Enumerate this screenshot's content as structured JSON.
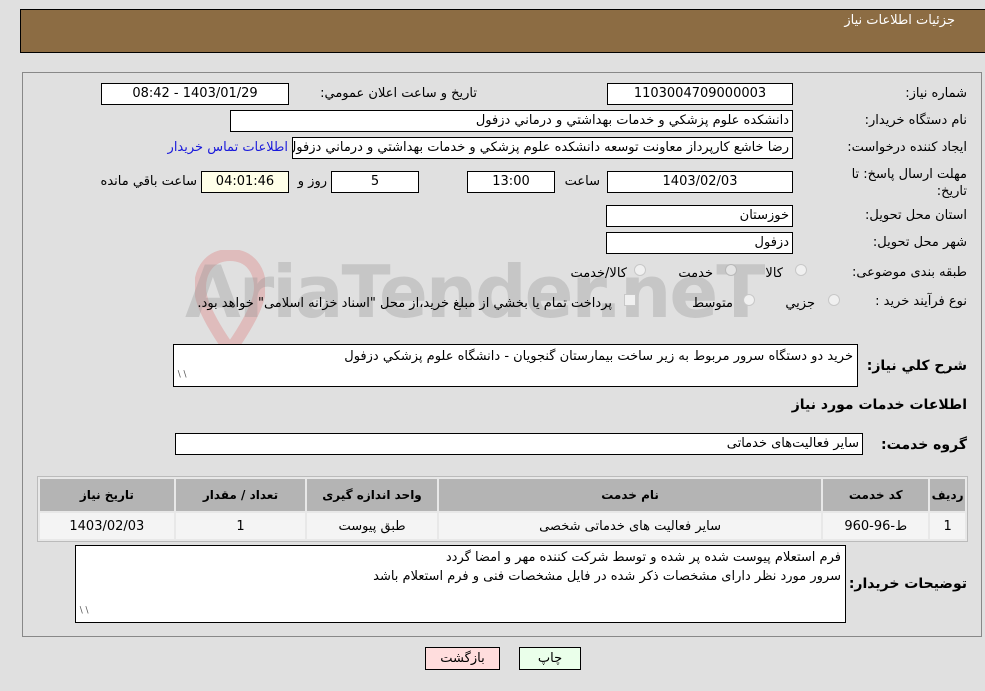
{
  "header": {
    "title": "جزئيات اطلاعات نياز"
  },
  "fields": {
    "need_number": {
      "label": "شماره نياز:",
      "value": "1103004709000003"
    },
    "announce_datetime": {
      "label": "تاريخ و ساعت اعلان عمومي:",
      "value": "1403/01/29 - 08:42"
    },
    "buyer_org": {
      "label": "نام دستگاه خريدار:",
      "value": "دانشكده علوم پزشكي و خدمات بهداشتي و درماني دزفول"
    },
    "requester": {
      "label": "ايجاد كننده درخواست:",
      "value": "رضا خاشع كارپرداز معاونت توسعه دانشكده علوم پزشكي و خدمات بهداشتي و درماني دزفول",
      "contact_link": "اطلاعات تماس خريدار"
    },
    "deadline": {
      "label": "مهلت ارسال پاسخ: تا تاريخ:",
      "date": "1403/02/03",
      "time_label": "ساعت",
      "time": "13:00",
      "days": "5",
      "days_label": "روز و",
      "remaining": "04:01:46",
      "remaining_label": "ساعت باقي مانده"
    },
    "province": {
      "label": "استان محل تحويل:",
      "value": "خوزستان"
    },
    "city": {
      "label": "شهر محل تحويل:",
      "value": "دزفول"
    },
    "category": {
      "label": "طبقه بندی موضوعی:",
      "options": [
        "كالا",
        "خدمت",
        "كالا/خدمت"
      ],
      "selected": "خدمت"
    },
    "purchase_type": {
      "label": "نوع فرآيند خريد :",
      "options": [
        "جزيي",
        "متوسط"
      ],
      "selected": "",
      "treasury_note": "پرداخت تمام يا بخشي از مبلغ خريد،از محل \"اسناد خزانه اسلامی\" خواهد بود."
    }
  },
  "description": {
    "label": "شرح كلي نياز:",
    "value": "خريد دو دستگاه سرور مربوط به زير ساخت بيمارستان گنجويان - دانشگاه علوم پزشكي دزفول"
  },
  "services_section": {
    "title": "اطلاعات خدمات مورد نياز"
  },
  "service_group": {
    "label": "گروه خدمت:",
    "value": "ساير فعاليت‌هاى خدماتى"
  },
  "table": {
    "columns": [
      "رديف",
      "كد خدمت",
      "نام خدمت",
      "واحد اندازه گيری",
      "تعداد / مقدار",
      "تاريخ نياز"
    ],
    "rows": [
      [
        "1",
        "ط-96-960",
        "ساير فعاليت هاى خدماتى شخصى",
        "طبق پيوست",
        "1",
        "1403/02/03"
      ]
    ]
  },
  "buyer_notes": {
    "label": "توضيحات خريدار:",
    "lines": [
      "فرم استعلام پيوست شده پر شده و توسط شركت كننده مهر و امضا گردد",
      "سرور مورد نظر داراى مشخصات ذكر شده در فايل مشخصات فنى  و فرم استعلام باشد"
    ]
  },
  "buttons": {
    "print": "چاپ",
    "back": "بازگشت"
  },
  "watermark": {
    "text": "AriaTender.neT"
  },
  "colors": {
    "header_bg": "#8c6c43",
    "print_bg": "#eaffea",
    "back_bg": "#ffdddd",
    "link": "#1a1adb"
  }
}
